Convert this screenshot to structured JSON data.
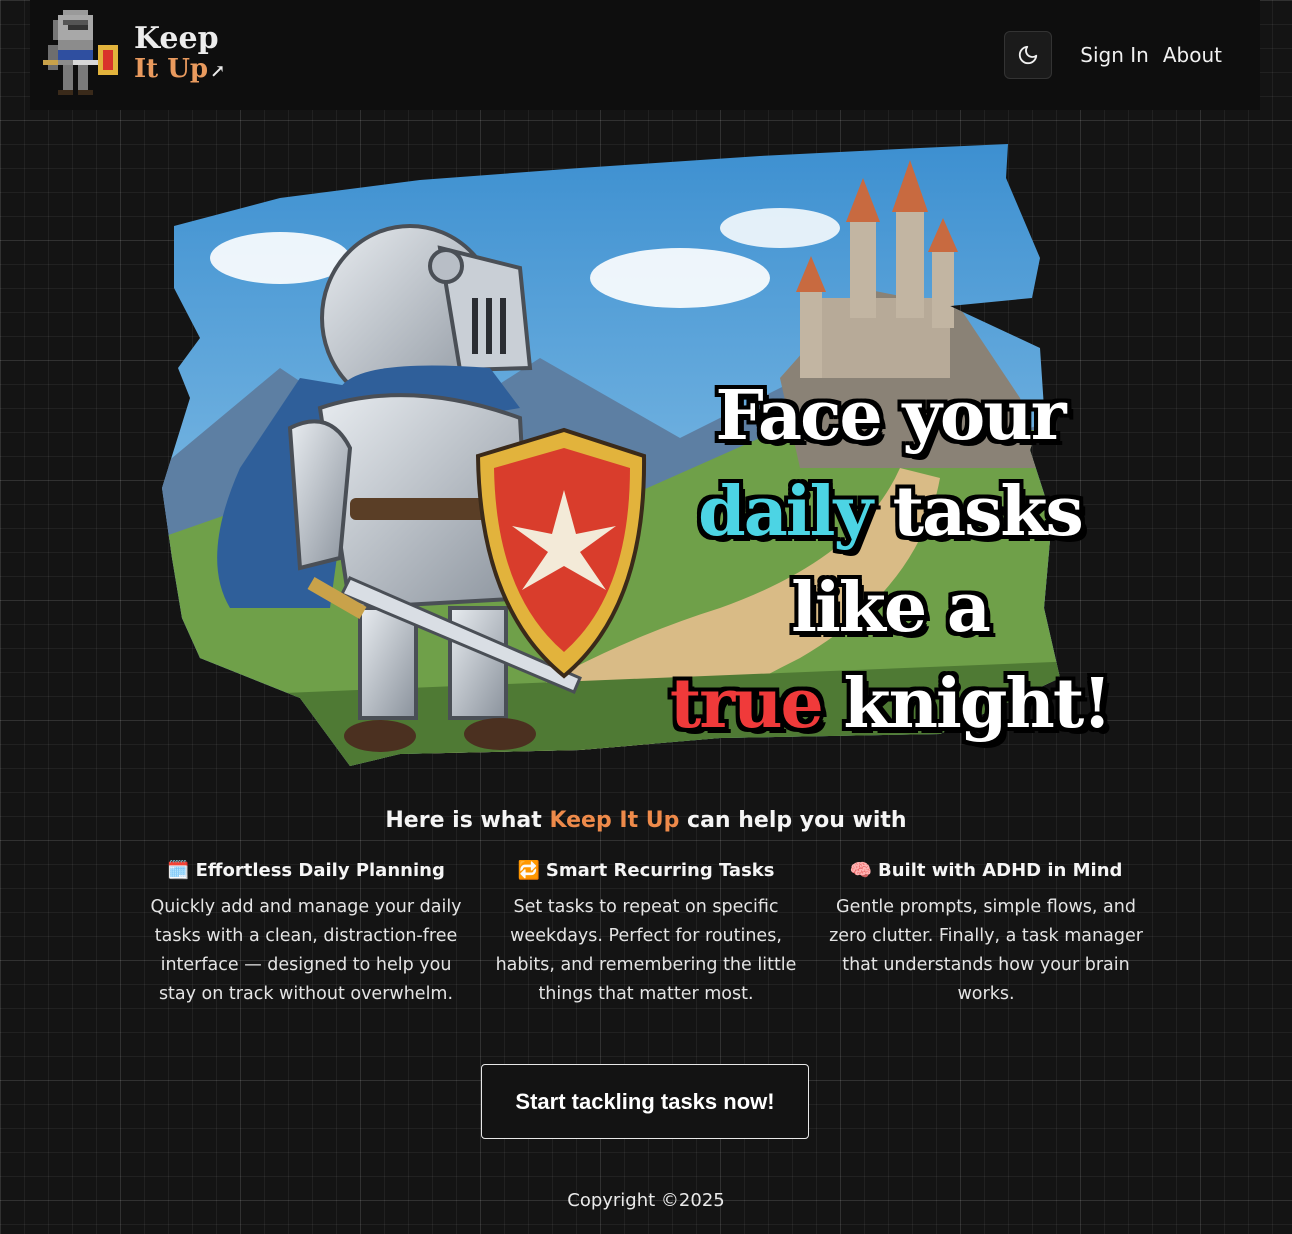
{
  "header": {
    "brand": {
      "line1": "Keep",
      "line2": "It Up",
      "arrow": "↗"
    },
    "theme_toggle_icon": "moon-icon",
    "nav": [
      {
        "label": "Sign In"
      },
      {
        "label": "About"
      }
    ]
  },
  "hero": {
    "image": "knight-with-shield-and-castle-illustration",
    "headline": {
      "row1": "Face your",
      "row2_highlight": "daily",
      "row2_rest": "tasks",
      "row3": "like a",
      "row4_highlight": "true",
      "row4_rest": "knight!"
    },
    "colors": {
      "highlight_cyan": "#4cd4e4",
      "highlight_red": "#f03a3a"
    }
  },
  "features": {
    "title_before": "Here is what",
    "title_brand": "Keep It Up",
    "title_after": "can help you with",
    "accent_color": "#ee8a4a",
    "items": [
      {
        "icon": "🗓️",
        "title": "Effortless Daily Planning",
        "text": "Quickly add and manage your daily tasks with a clean, distraction-free interface — designed to help you stay on track without overwhelm."
      },
      {
        "icon": "🔁",
        "title": "Smart Recurring Tasks",
        "text": "Set tasks to repeat on specific weekdays. Perfect for routines, habits, and remembering the little things that matter most."
      },
      {
        "icon": "🧠",
        "title": "Built with ADHD in Mind",
        "text": "Gentle prompts, simple flows, and zero clutter. Finally, a task manager that understands how your brain works."
      }
    ]
  },
  "cta": {
    "label": "Start tackling tasks now!"
  },
  "footer": {
    "copyright": "Copyright ©2025"
  }
}
